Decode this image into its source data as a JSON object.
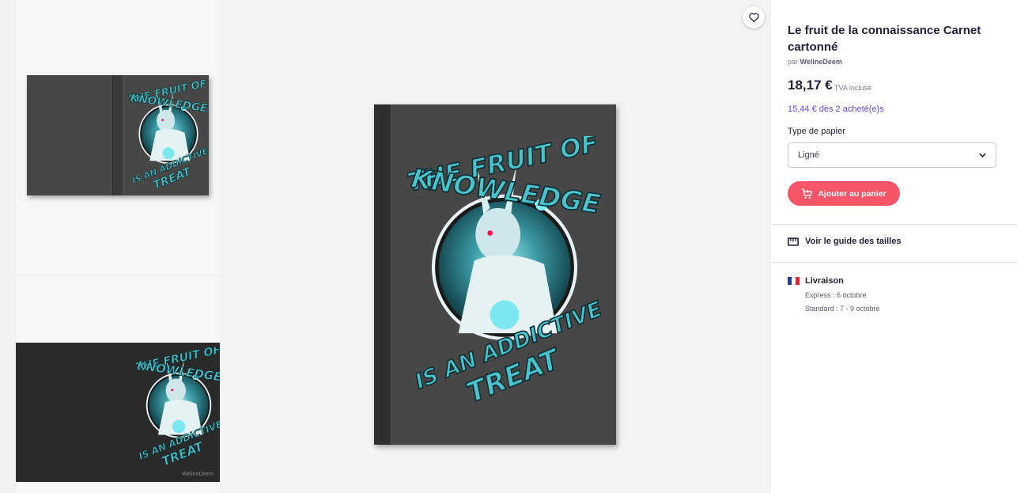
{
  "product": {
    "title": "Le fruit de la connaissance Carnet cartonné",
    "by_prefix": "par",
    "artist": "WelineDeem",
    "price": "18,17 €",
    "tax_note": "TVA incluse",
    "bulk_price": "15,44 € dès 2 acheté(e)s",
    "paper_type_label": "Type de papier",
    "paper_type_value": "Ligné",
    "add_to_cart": "Ajouter au panier",
    "size_guide": "Voir le guide des tailles"
  },
  "shipping": {
    "title": "Livraison",
    "express": "Express : 6 octobre",
    "standard": "Standard : 7 - 9 octobre"
  },
  "artwork": {
    "line1": "THE FRUIT OF",
    "line2": "KNOWLEDGE",
    "line3": "IS AN ADDICTIVE",
    "line4": "TREAT",
    "watermark": "WelineDeem"
  },
  "colors": {
    "accent": "#f65567",
    "bulk": "#6a45d0",
    "teal": "#49c3cc",
    "book": "#474747"
  },
  "icons": {
    "favorite": "heart-icon",
    "cart": "cart-plus-icon",
    "select": "chevron-down-icon",
    "ruler": "ruler-icon",
    "flag": "flag-fr-icon"
  }
}
